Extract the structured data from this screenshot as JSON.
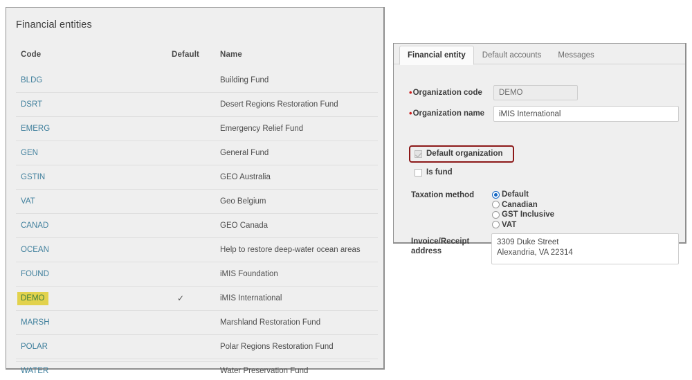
{
  "entities_panel": {
    "title": "Financial entities",
    "columns": {
      "code": "Code",
      "default": "Default",
      "name": "Name"
    },
    "rows": [
      {
        "code": "BLDG",
        "default": "",
        "name": "Building Fund"
      },
      {
        "code": "DSRT",
        "default": "",
        "name": "Desert Regions Restoration Fund"
      },
      {
        "code": "EMERG",
        "default": "",
        "name": "Emergency Relief Fund"
      },
      {
        "code": "GEN",
        "default": "",
        "name": "General Fund"
      },
      {
        "code": "GSTIN",
        "default": "",
        "name": "GEO Australia"
      },
      {
        "code": "VAT",
        "default": "",
        "name": "Geo Belgium"
      },
      {
        "code": "CANAD",
        "default": "",
        "name": "GEO Canada"
      },
      {
        "code": "OCEAN",
        "default": "",
        "name": "Help to restore deep-water ocean areas"
      },
      {
        "code": "FOUND",
        "default": "",
        "name": "iMIS Foundation"
      },
      {
        "code": "DEMO",
        "default": "✓",
        "name": "iMIS International",
        "highlighted": true
      },
      {
        "code": "MARSH",
        "default": "",
        "name": "Marshland Restoration Fund"
      },
      {
        "code": "POLAR",
        "default": "",
        "name": "Polar Regions Restoration Fund"
      },
      {
        "code": "WATER",
        "default": "",
        "name": "Water Preservation Fund"
      }
    ],
    "highlight_color": "#e2d24d",
    "link_color": "#3f7f9c"
  },
  "entity_panel": {
    "tabs": [
      {
        "label": "Financial entity",
        "active": true
      },
      {
        "label": "Default accounts",
        "active": false
      },
      {
        "label": "Messages",
        "active": false
      }
    ],
    "fields": {
      "org_code_label": "Organization code",
      "org_code_value": "DEMO",
      "org_code_placeholder": "",
      "org_name_label": "Organization name",
      "org_name_value": "iMIS International",
      "org_name_placeholder": "",
      "default_org_label": "Default organization",
      "default_org_checked": true,
      "is_fund_label": "Is fund",
      "is_fund_checked": false,
      "taxation_label": "Taxation method",
      "taxation_options": [
        {
          "label": "Default",
          "selected": true
        },
        {
          "label": "Canadian",
          "selected": false
        },
        {
          "label": "GST Inclusive",
          "selected": false
        },
        {
          "label": "VAT",
          "selected": false
        }
      ],
      "address_label_line1": "Invoice/Receipt",
      "address_label_line2": "address",
      "address_value": "3309 Duke Street\nAlexandria, VA 22314",
      "address_placeholder": ""
    },
    "required_marker": "•",
    "callout_color": "#8c1818"
  }
}
